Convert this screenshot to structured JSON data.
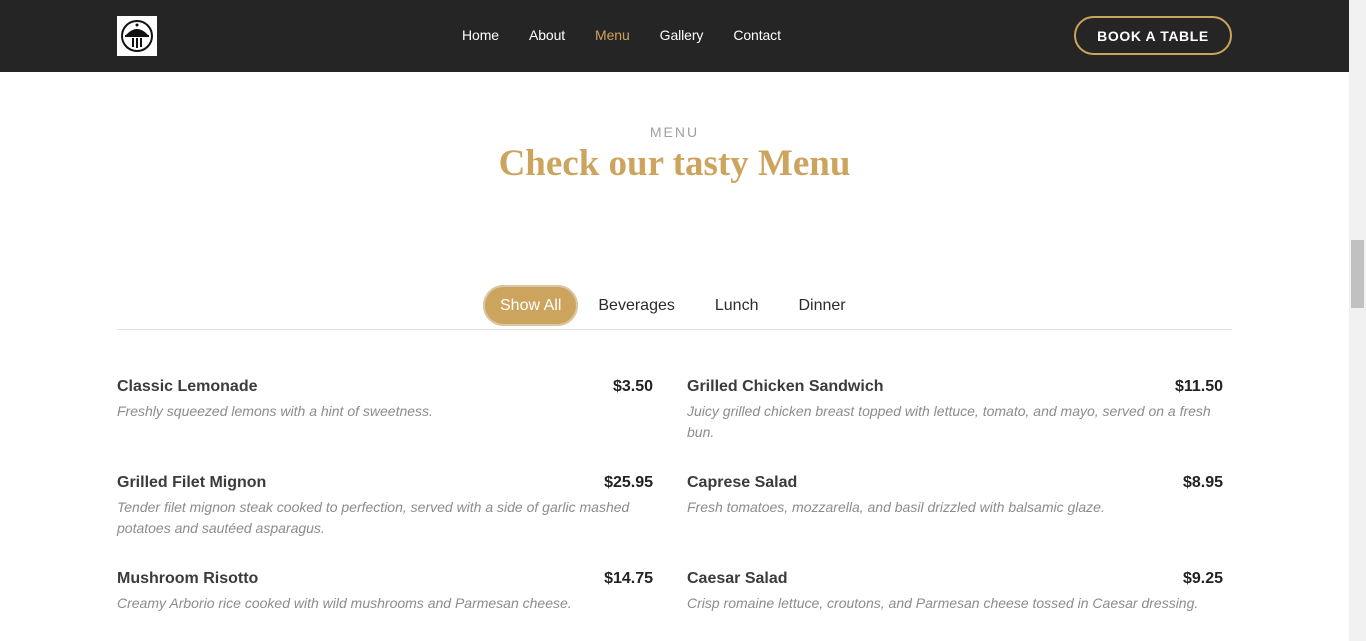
{
  "header": {
    "logo_icon": "restaurant-cloche-icon",
    "nav": [
      {
        "label": "Home",
        "active": false
      },
      {
        "label": "About",
        "active": false
      },
      {
        "label": "Menu",
        "active": true
      },
      {
        "label": "Gallery",
        "active": false
      },
      {
        "label": "Contact",
        "active": false
      }
    ],
    "book_button": "BOOK A TABLE"
  },
  "section": {
    "label": "MENU",
    "title": "Check our tasty Menu"
  },
  "filters": [
    {
      "label": "Show All",
      "active": true
    },
    {
      "label": "Beverages",
      "active": false
    },
    {
      "label": "Lunch",
      "active": false
    },
    {
      "label": "Dinner",
      "active": false
    }
  ],
  "menu_items": [
    {
      "name": "Classic Lemonade",
      "price": "$3.50",
      "desc": "Freshly squeezed lemons with a hint of sweetness."
    },
    {
      "name": "Grilled Chicken Sandwich",
      "price": "$11.50",
      "desc": "Juicy grilled chicken breast topped with lettuce, tomato, and mayo, served on a fresh bun."
    },
    {
      "name": "Grilled Filet Mignon",
      "price": "$25.95",
      "desc": "Tender filet mignon steak cooked to perfection, served with a side of garlic mashed potatoes and sautéed asparagus."
    },
    {
      "name": "Caprese Salad",
      "price": "$8.95",
      "desc": "Fresh tomatoes, mozzarella, and basil drizzled with balsamic glaze."
    },
    {
      "name": "Mushroom Risotto",
      "price": "$14.75",
      "desc": "Creamy Arborio rice cooked with wild mushrooms and Parmesan cheese."
    },
    {
      "name": "Caesar Salad",
      "price": "$9.25",
      "desc": "Crisp romaine lettuce, croutons, and Parmesan cheese tossed in Caesar dressing."
    }
  ],
  "colors": {
    "accent": "#cda45e",
    "header_bg": "#252525"
  }
}
